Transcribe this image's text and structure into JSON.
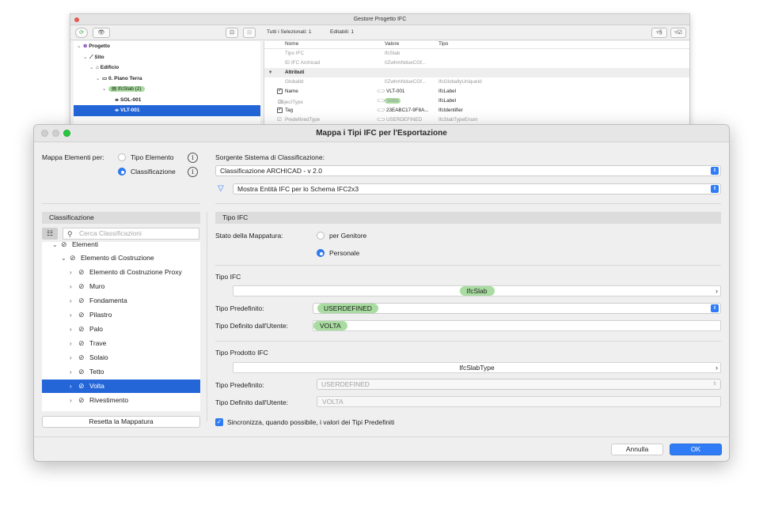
{
  "bg_window": {
    "title": "Gestore Progetto IFC",
    "header": {
      "selected_all": "Tutti i Selezionati: 1",
      "editable": "Editabili: 1"
    },
    "tree": [
      {
        "label": "Progetto",
        "chev": "⌄",
        "indent": 0
      },
      {
        "label": "Sito",
        "chev": "⌄",
        "indent": 1
      },
      {
        "label": "Edificio",
        "chev": "⌄",
        "indent": 2
      },
      {
        "label": "0. Piano Terra",
        "chev": "⌄",
        "indent": 3
      },
      {
        "label": "IfcSlab (2)",
        "chev": "⌄",
        "indent": 4
      },
      {
        "label": "SOL-001",
        "chev": "",
        "indent": 5
      },
      {
        "label": "VLT-001",
        "chev": "",
        "indent": 5
      }
    ],
    "columns": [
      "Nome",
      "Valore",
      "Tipo"
    ],
    "rows": [
      {
        "name": "Tipo IFC",
        "value": "IfcSlab",
        "type": ""
      },
      {
        "name": "ID IFC Archicad",
        "value": "0ZwhmNdueCGf...",
        "type": ""
      },
      {
        "name": "Attributi",
        "value": "",
        "type": ""
      },
      {
        "name": "GlobalId",
        "value": "0ZwhmNdueCGf...",
        "type": "IfcGloballyUniqueId"
      },
      {
        "name": "Name",
        "value": "VLT-001",
        "type": "IfcLabel"
      },
      {
        "name": "ObjectType",
        "value": "Volta",
        "type": "IfcLabel"
      },
      {
        "name": "Tag",
        "value": "23EABC17-9F8A...",
        "type": "IfcIdentifier"
      },
      {
        "name": "PredefinedType",
        "value": "USERDEFINED",
        "type": "IfcSlabTypeEnum"
      }
    ]
  },
  "dialog": {
    "title": "Mappa i Tipi IFC per l'Esportazione",
    "map_by_label": "Mappa Elementi per:",
    "map_opt_type": "Tipo Elemento",
    "map_opt_class": "Classificazione",
    "source_label": "Sorgente Sistema di Classificazione:",
    "source_value": "Classificazione ARCHICAD - v 2.0",
    "filter_value": "Mostra Entità IFC per lo Schema IFC2x3",
    "left_header": "Classificazione",
    "search_placeholder": "Cerca Classificazioni",
    "class_tree": [
      {
        "label": "Elementi",
        "chev": "⌄",
        "indent": 0,
        "selected": false
      },
      {
        "label": "Elemento di Costruzione",
        "chev": "⌄",
        "indent": 1,
        "selected": false
      },
      {
        "label": "Elemento di Costruzione Proxy",
        "chev": "›",
        "indent": 2,
        "selected": false
      },
      {
        "label": "Muro",
        "chev": "›",
        "indent": 2,
        "selected": false
      },
      {
        "label": "Fondamenta",
        "chev": "›",
        "indent": 2,
        "selected": false
      },
      {
        "label": "Pilastro",
        "chev": "›",
        "indent": 2,
        "selected": false
      },
      {
        "label": "Palo",
        "chev": "›",
        "indent": 2,
        "selected": false
      },
      {
        "label": "Trave",
        "chev": "›",
        "indent": 2,
        "selected": false
      },
      {
        "label": "Solaio",
        "chev": "›",
        "indent": 2,
        "selected": false
      },
      {
        "label": "Tetto",
        "chev": "›",
        "indent": 2,
        "selected": false
      },
      {
        "label": "Volta",
        "chev": "›",
        "indent": 2,
        "selected": true
      },
      {
        "label": "Rivestimento",
        "chev": "›",
        "indent": 2,
        "selected": false
      }
    ],
    "reset_button": "Resetta la Mappatura",
    "right_header": "Tipo IFC",
    "mapping_state_label": "Stato della Mappatura:",
    "state_parent": "per Genitore",
    "state_custom": "Personale",
    "ifc_type_label": "Tipo IFC",
    "ifc_type_value": "IfcSlab",
    "predef_label": "Tipo Predefinito:",
    "predef_value": "USERDEFINED",
    "userdef_label": "Tipo Definito dall'Utente:",
    "userdef_value": "VOLTA",
    "product_type_label": "Tipo Prodotto IFC",
    "product_type_value": "IfcSlabType",
    "predef2_label": "Tipo Predefinito:",
    "predef2_value": "USERDEFINED",
    "userdef2_label": "Tipo Definito dall'Utente:",
    "userdef2_value": "VOLTA",
    "sync_label": "Sincronizza, quando possibile, i valori dei Tipi Predefiniti",
    "cancel_button": "Annulla",
    "ok_button": "OK"
  },
  "colors": {
    "accent": "#2f7cf6",
    "selection": "#2466d8",
    "highlight_pill": "#a9dca0"
  }
}
